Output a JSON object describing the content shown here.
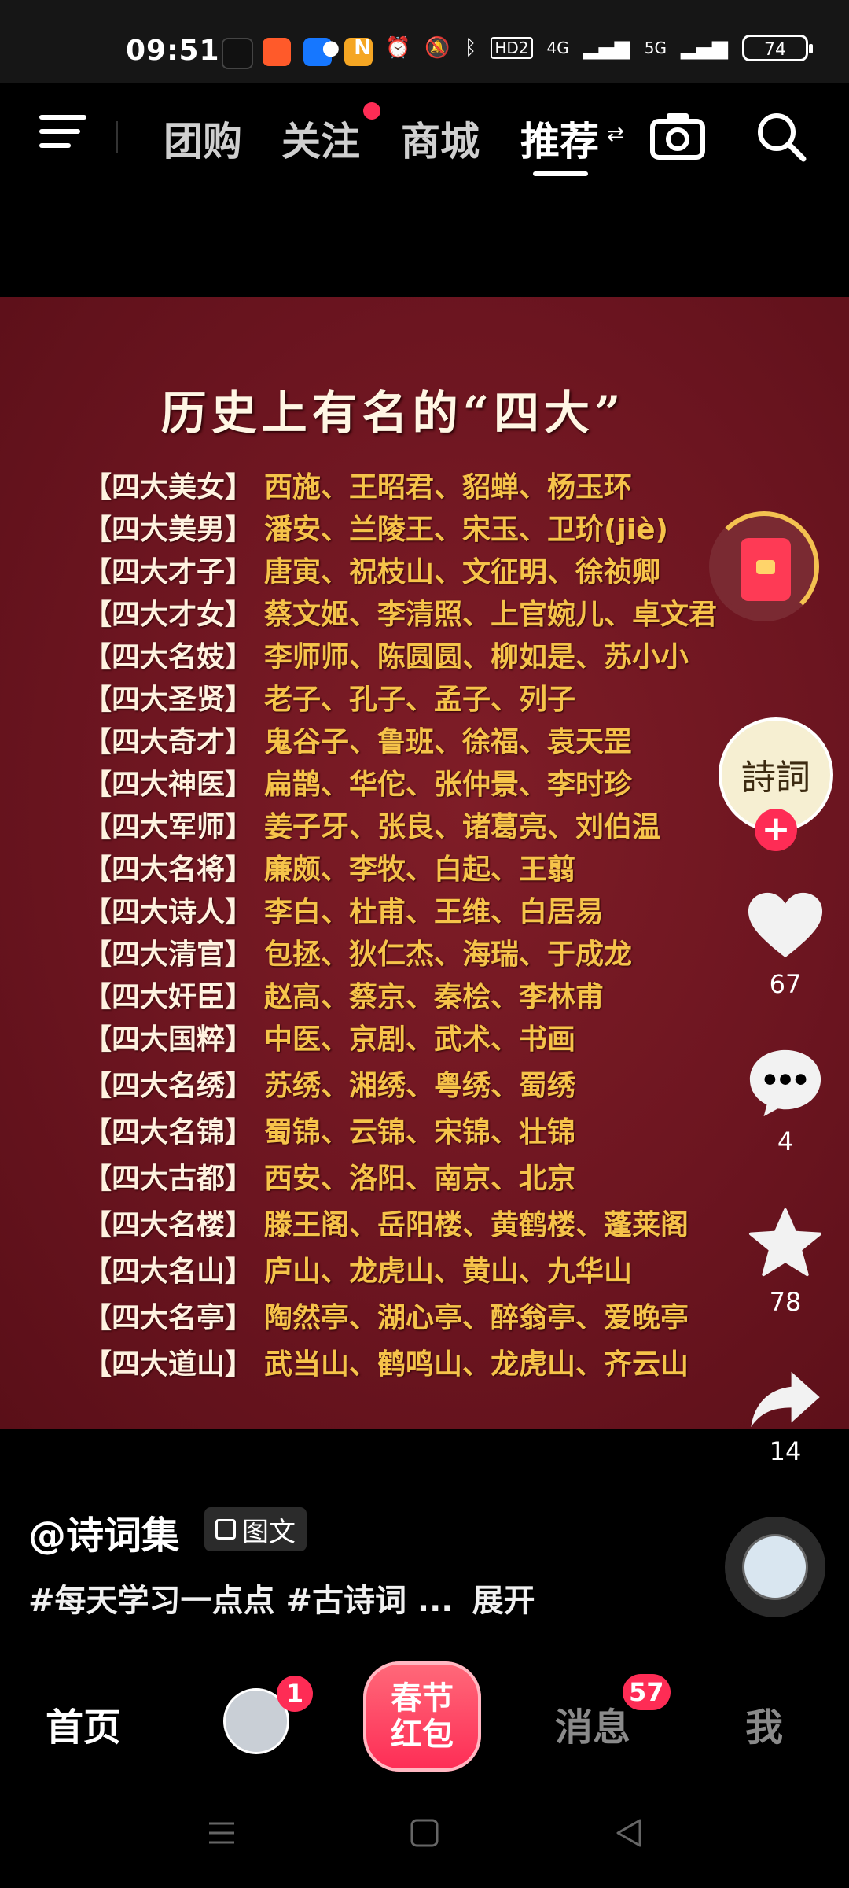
{
  "status_bar": {
    "time": "09:51",
    "network_label": "4G",
    "network_label2": "5G",
    "hd_label": "HD2",
    "battery": "74"
  },
  "top_nav": {
    "tabs": [
      "团购",
      "关注",
      "商城",
      "推荐"
    ],
    "active_tab": "推荐"
  },
  "post": {
    "title": "历史上有名的“四大”",
    "items": [
      {
        "key": "【四大美女】",
        "value": "西施、王昭君、貂蝉、杨玉环"
      },
      {
        "key": "【四大美男】",
        "value": "潘安、兰陵王、宋玉、卫玠(jiè)"
      },
      {
        "key": "【四大才子】",
        "value": "唐寅、祝枝山、文征明、徐祯卿"
      },
      {
        "key": "【四大才女】",
        "value": "蔡文姬、李清照、上官婉儿、卓文君"
      },
      {
        "key": "【四大名妓】",
        "value": "李师师、陈圆圆、柳如是、苏小小"
      },
      {
        "key": "【四大圣贤】",
        "value": "老子、孔子、孟子、列子"
      },
      {
        "key": "【四大奇才】",
        "value": "鬼谷子、鲁班、徐福、袁天罡"
      },
      {
        "key": "【四大神医】",
        "value": "扁鹊、华佗、张仲景、李时珍"
      },
      {
        "key": "【四大军师】",
        "value": "姜子牙、张良、诸葛亮、刘伯温"
      },
      {
        "key": "【四大名将】",
        "value": "廉颇、李牧、白起、王翦"
      },
      {
        "key": "【四大诗人】",
        "value": "李白、杜甫、王维、白居易"
      },
      {
        "key": "【四大清官】",
        "value": "包拯、狄仁杰、海瑞、于成龙"
      },
      {
        "key": "【四大奸臣】",
        "value": "赵高、蔡京、秦桧、李林甫"
      },
      {
        "key": "【四大国粹】",
        "value": "中医、京剧、武术、书画"
      },
      {
        "key": "【四大名绣】",
        "value": "苏绣、湘绣、粤绣、蜀绣"
      },
      {
        "key": "【四大名锦】",
        "value": "蜀锦、云锦、宋锦、壮锦"
      },
      {
        "key": "【四大古都】",
        "value": "西安、洛阳、南京、北京"
      },
      {
        "key": "【四大名楼】",
        "value": "滕王阁、岳阳楼、黄鹤楼、蓬莱阁"
      },
      {
        "key": "【四大名山】",
        "value": "庐山、龙虎山、黄山、九华山"
      },
      {
        "key": "【四大名亭】",
        "value": "陶然亭、湖心亭、醉翁亭、爱晚亭"
      },
      {
        "key": "【四大道山】",
        "value": "武当山、鹤鸣山、龙虎山、齐云山"
      }
    ]
  },
  "side_actions": {
    "avatar_text": "詩詞",
    "likes": "67",
    "comments": "4",
    "favorites": "78",
    "shares": "14"
  },
  "caption": {
    "author": "@诗词集",
    "badge": "图文",
    "description": "#每天学习一点点 #古诗词 ...",
    "expand": "展开"
  },
  "bottom_nav": {
    "home": "首页",
    "friends_badge": "1",
    "cny_line1": "春节",
    "cny_line2": "红包",
    "messages": "消息",
    "messages_badge": "57",
    "me": "我"
  }
}
